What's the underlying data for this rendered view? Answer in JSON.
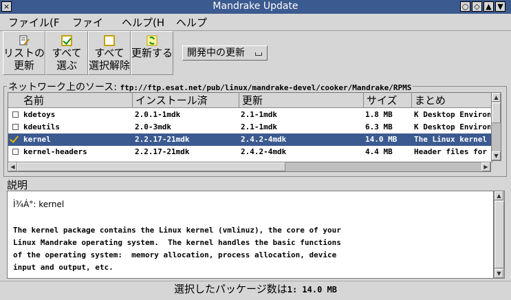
{
  "window": {
    "title": "Mandrake Update"
  },
  "menu": [
    "ファイル(F",
    "ファイ",
    "ヘルプ(H",
    "ヘルプ"
  ],
  "toolbar": [
    {
      "line1": "リストの",
      "line2": "更新",
      "icon": "edit-list-icon"
    },
    {
      "line1": "すべて",
      "line2": "選ぶ",
      "icon": "checkbox-checked-icon"
    },
    {
      "line1": "すべて",
      "line2": "選択解除",
      "icon": "checkbox-empty-icon"
    },
    {
      "line1": "更新する",
      "line2": "",
      "icon": "update-arrows-icon"
    }
  ],
  "dev_dropdown": {
    "label": "開発中の更新"
  },
  "source": {
    "label": "ネットワーク上のソース:",
    "url": "ftp://ftp.esat.net/pub/linux/mandrake-devel/cooker/Mandrake/RPMS"
  },
  "table": {
    "columns": [
      "名前",
      "インストール済",
      "更新",
      "サイズ",
      "まとめ"
    ],
    "rows": [
      {
        "checked": false,
        "selected": false,
        "name": "kdetoys",
        "installed": "2.0.1-1mdk",
        "update": "2.1-1mdk",
        "size": "1.8 MB",
        "summary": "K Desktop Environment"
      },
      {
        "checked": false,
        "selected": false,
        "name": "kdeutils",
        "installed": "2.0-3mdk",
        "update": "2.1-1mdk",
        "size": "6.3 MB",
        "summary": "K Desktop Environment"
      },
      {
        "checked": true,
        "selected": true,
        "name": "kernel",
        "installed": "2.2.17-21mdk",
        "update": "2.4.2-4mdk",
        "size": "14.0 MB",
        "summary": "The Linux kernel"
      },
      {
        "checked": false,
        "selected": false,
        "name": "kernel-headers",
        "installed": "2.2.17-21mdk",
        "update": "2.4.2-4mdk",
        "size": "4.4 MB",
        "summary": "Header files for"
      }
    ]
  },
  "description": {
    "label": "説明",
    "title": "Ì¾Á°: kernel",
    "lines": [
      "The kernel package contains the Linux kernel (vmlinuz), the core of your",
      "Linux Mandrake operating system.  The kernel handles the basic functions",
      "of the operating system:  memory allocation, process allocation, device",
      "input and output, etc."
    ]
  },
  "status": {
    "label": "選択したパッケージ数は",
    "value": "1: 14.0 MB"
  },
  "colors": {
    "titlebar": "#3b5a8f",
    "selection": "#3b5a8f",
    "background": "#d6d6d6"
  }
}
